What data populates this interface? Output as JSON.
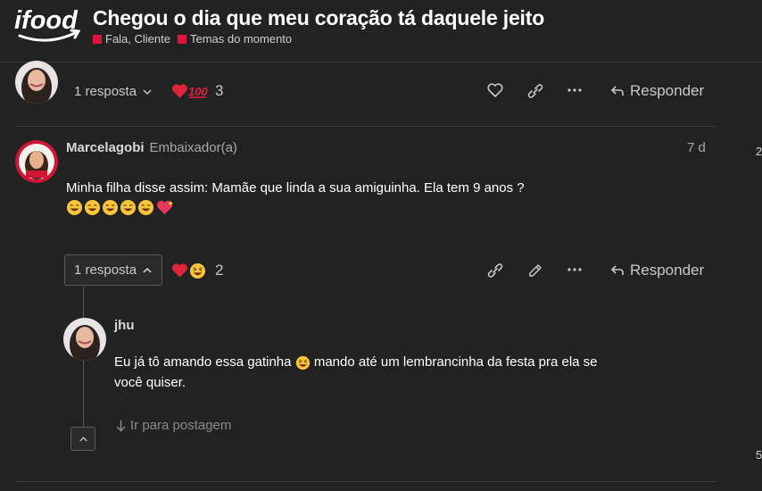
{
  "header": {
    "logo_text": "ifood",
    "title": "Chegou o dia que meu coração tá daquele jeito",
    "categories": [
      {
        "label": "Fala, Cliente",
        "color": "#e0123f"
      },
      {
        "label": "Temas do momento",
        "color": "#e0123f"
      }
    ]
  },
  "post_top": {
    "replies_label": "1 resposta",
    "reaction_count": "3",
    "reply_label": "Responder",
    "reactions": [
      "heart",
      "hundred"
    ]
  },
  "post_main": {
    "username": "Marcelagobi",
    "user_title": "Embaixador(a)",
    "date": "7 d",
    "text": "Minha filha disse assim: Mamãe que linda a sua amiguinha. Ela tem 9 anos ?",
    "emojis": [
      "grin",
      "grin",
      "grin",
      "grin",
      "grin",
      "sparkling-heart"
    ],
    "replies_label": "1 resposta",
    "reaction_count": "2",
    "reply_label": "Responder",
    "reactions": [
      "heart",
      "laughing"
    ]
  },
  "reply": {
    "username": "jhu",
    "text_line1": "Eu já tô amando essa gatinha",
    "text_line1_after": " mando até um lembrancinha da festa pra ela se",
    "text_line2": "você quiser.",
    "goto_label": "Ir para postagem"
  },
  "side": {
    "char_top": "2",
    "char_bottom": "5"
  },
  "colors": {
    "background": "#222222",
    "accent_red": "#e0123f",
    "text_primary": "#ffffff",
    "text_muted": "#b5b5b5"
  }
}
